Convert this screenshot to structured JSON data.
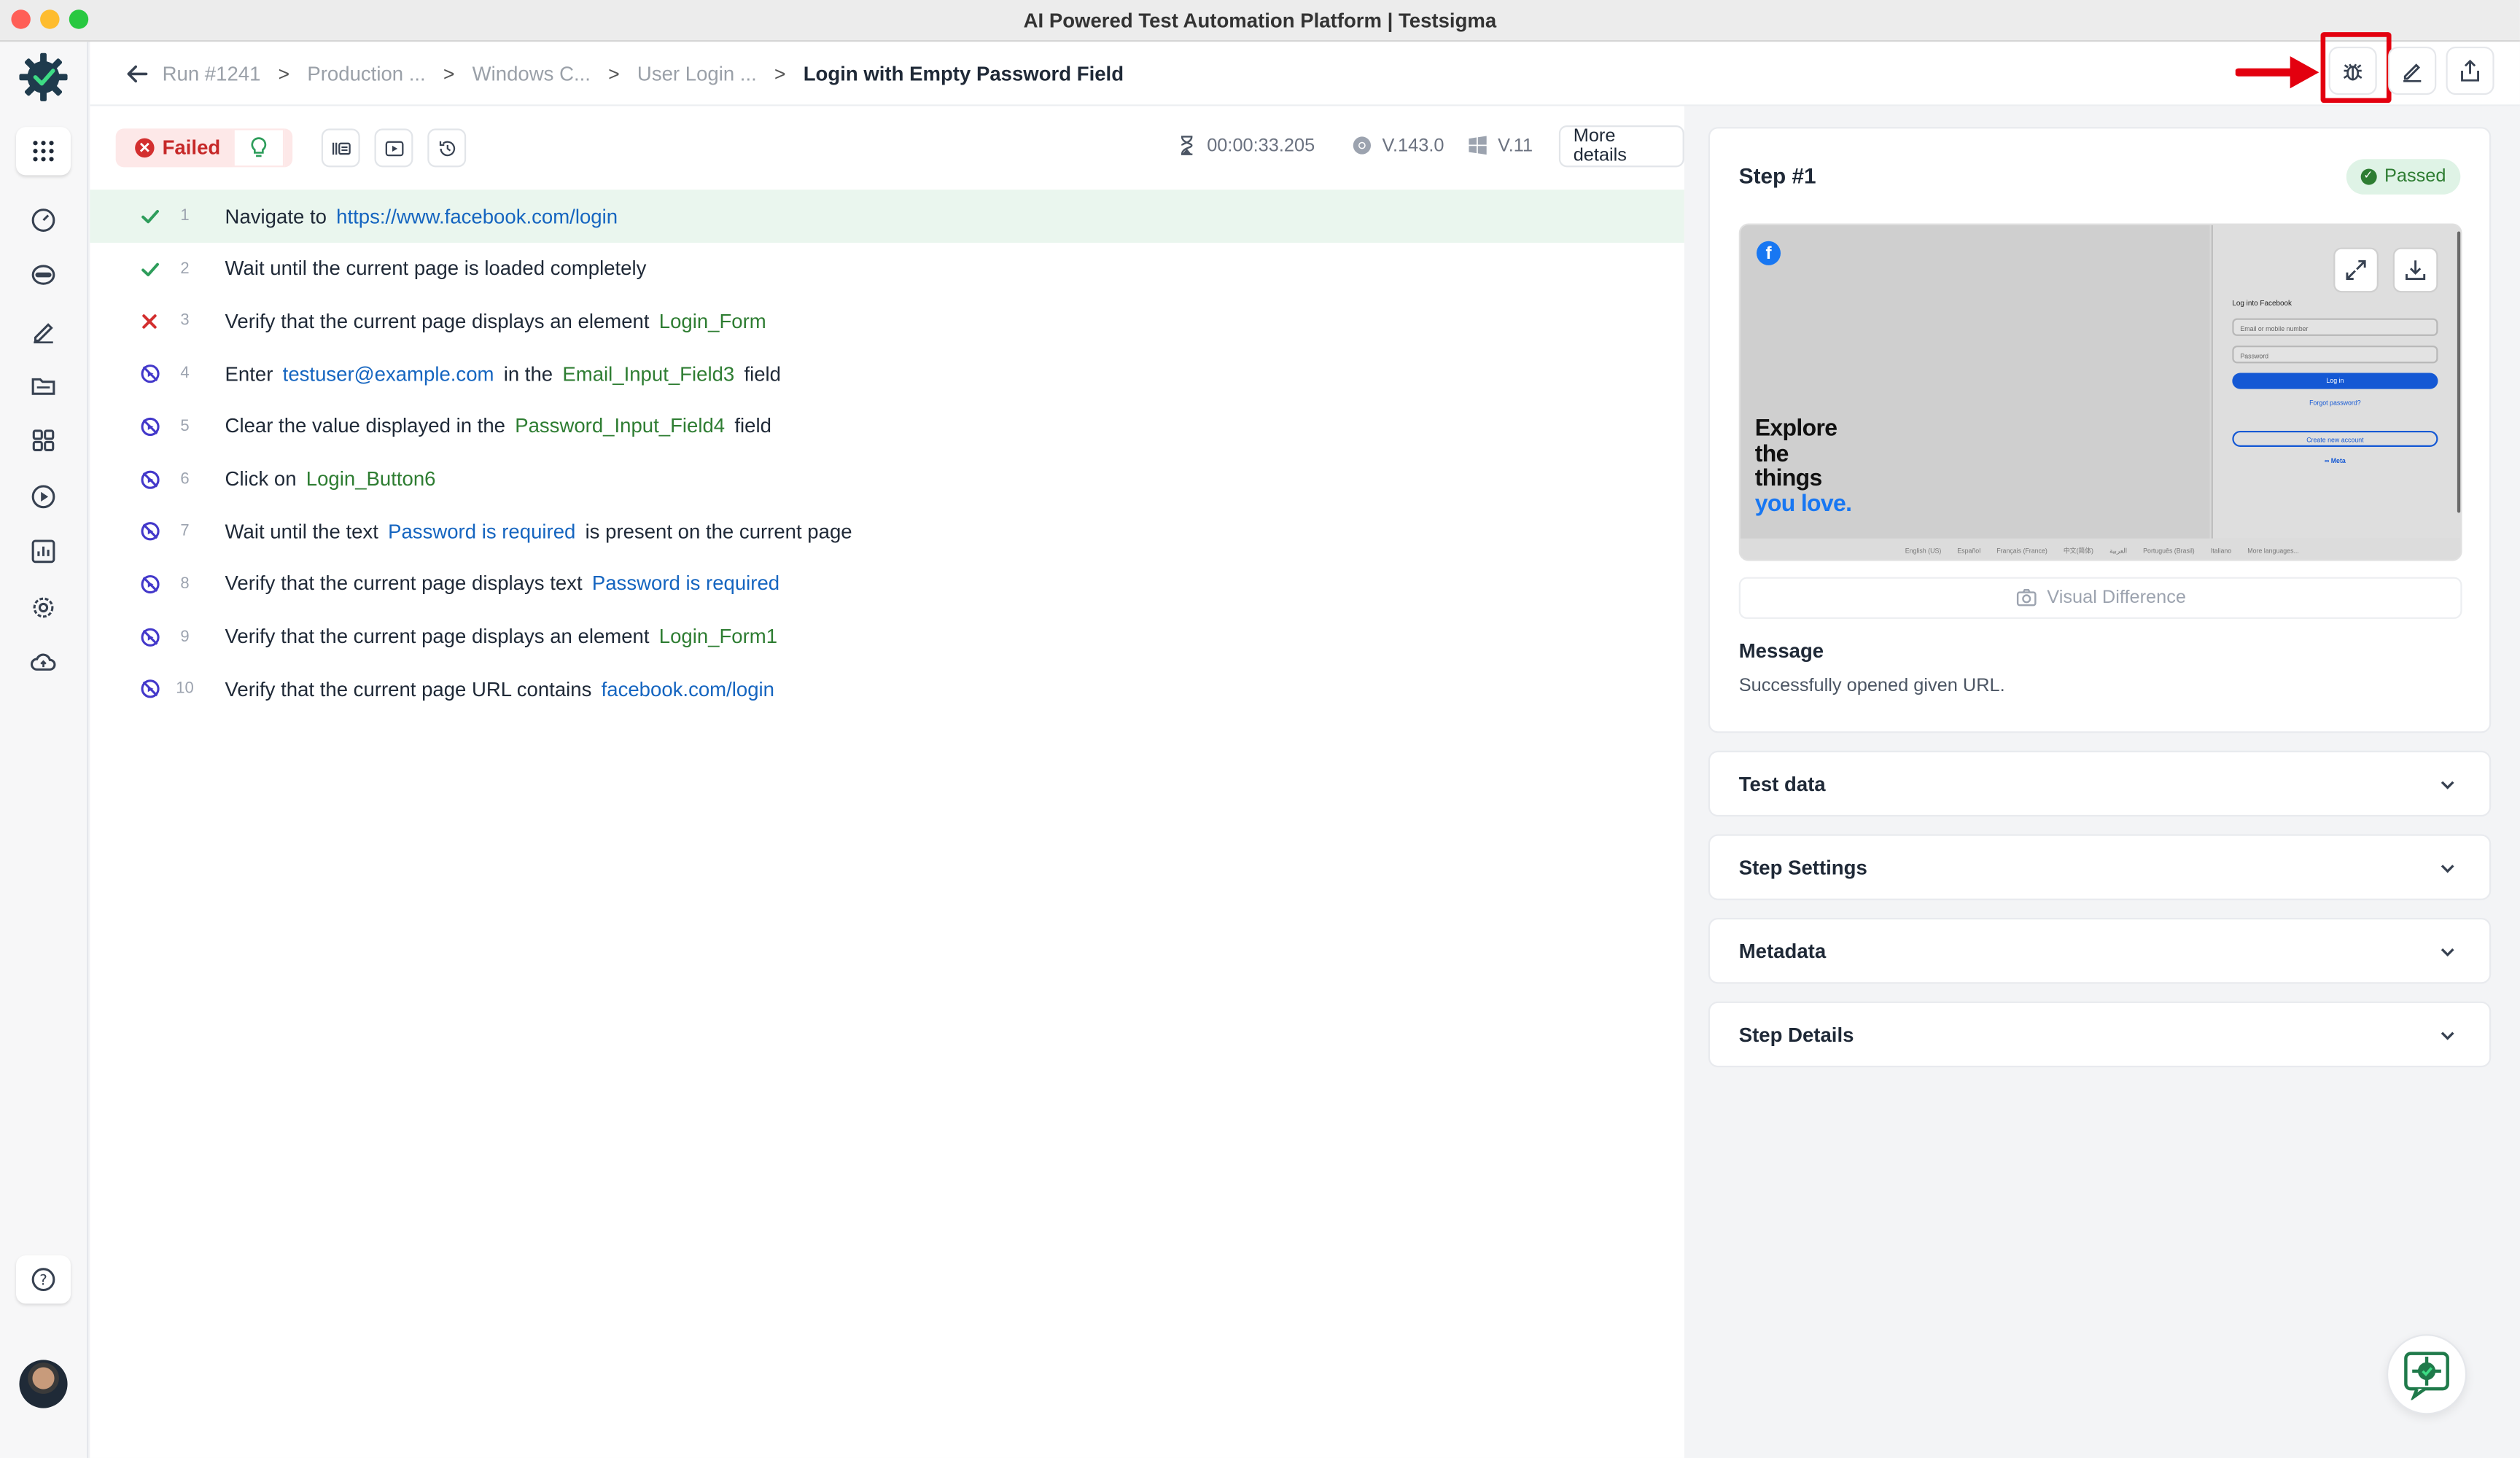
{
  "window": {
    "title": "AI Powered Test Automation Platform | Testsigma"
  },
  "breadcrumb": {
    "items": [
      "Run #1241",
      "Production ...",
      "Windows C...",
      "User Login ...",
      "Login with Empty Password Field"
    ]
  },
  "toolbar": {
    "status_label": "Failed",
    "duration": "00:00:33.205",
    "browser_version": "V.143.0",
    "os_version": "V.11",
    "more_details_label": "More details"
  },
  "steps": [
    {
      "num": "1",
      "status": "passed",
      "parts": [
        {
          "t": "Navigate to",
          "k": "plain"
        },
        {
          "t": "https://www.facebook.com/login",
          "k": "link"
        }
      ]
    },
    {
      "num": "2",
      "status": "passed",
      "parts": [
        {
          "t": "Wait until the current page is loaded completely",
          "k": "plain"
        }
      ]
    },
    {
      "num": "3",
      "status": "failed",
      "parts": [
        {
          "t": "Verify that the current page displays an element",
          "k": "plain"
        },
        {
          "t": "Login_Form",
          "k": "element"
        }
      ]
    },
    {
      "num": "4",
      "status": "skipped",
      "parts": [
        {
          "t": "Enter",
          "k": "plain"
        },
        {
          "t": "testuser@example.com",
          "k": "text"
        },
        {
          "t": "in the",
          "k": "plain"
        },
        {
          "t": "Email_Input_Field3",
          "k": "element"
        },
        {
          "t": "field",
          "k": "plain"
        }
      ]
    },
    {
      "num": "5",
      "status": "skipped",
      "parts": [
        {
          "t": "Clear the value displayed in the",
          "k": "plain"
        },
        {
          "t": "Password_Input_Field4",
          "k": "element"
        },
        {
          "t": "field",
          "k": "plain"
        }
      ]
    },
    {
      "num": "6",
      "status": "skipped",
      "parts": [
        {
          "t": "Click on",
          "k": "plain"
        },
        {
          "t": "Login_Button6",
          "k": "element"
        }
      ]
    },
    {
      "num": "7",
      "status": "skipped",
      "parts": [
        {
          "t": "Wait until the text",
          "k": "plain"
        },
        {
          "t": "Password is required",
          "k": "text"
        },
        {
          "t": "is present on the current page",
          "k": "plain"
        }
      ]
    },
    {
      "num": "8",
      "status": "skipped",
      "parts": [
        {
          "t": "Verify that the current page displays text",
          "k": "plain"
        },
        {
          "t": "Password is required",
          "k": "text"
        }
      ]
    },
    {
      "num": "9",
      "status": "skipped",
      "parts": [
        {
          "t": "Verify that the current page displays an element",
          "k": "plain"
        },
        {
          "t": "Login_Form1",
          "k": "element"
        }
      ]
    },
    {
      "num": "10",
      "status": "skipped",
      "parts": [
        {
          "t": "Verify that the current page URL contains",
          "k": "plain"
        },
        {
          "t": "facebook.com/login",
          "k": "text"
        }
      ]
    }
  ],
  "details": {
    "step_title": "Step #1",
    "status_label": "Passed",
    "screenshot": {
      "tagline_line1": "Explore",
      "tagline_line2": "the",
      "tagline_line3": "things",
      "tagline_line4": "you love.",
      "form_heading": "Log into Facebook",
      "email_placeholder": "Email or mobile number",
      "password_placeholder": "Password",
      "login_label": "Log in",
      "forgot_label": "Forgot password?",
      "create_label": "Create new account",
      "meta_label": "∞ Meta",
      "footer_links": [
        "English (US)",
        "Español",
        "Français (France)",
        "中文(简体)",
        "العربية",
        "Português (Brasil)",
        "Italiano",
        "More languages..."
      ]
    },
    "visual_diff_label": "Visual Difference",
    "message_label": "Message",
    "message_text": "Successfully opened given URL."
  },
  "accordions": [
    "Test data",
    "Step Settings",
    "Metadata",
    "Step Details"
  ],
  "colors": {
    "passed": "#2e9d5b",
    "failed": "#d32f2f",
    "skipped": "#4338ca",
    "link": "#1565c0",
    "element": "#2e7d32",
    "brand": "#1f3b4d"
  }
}
